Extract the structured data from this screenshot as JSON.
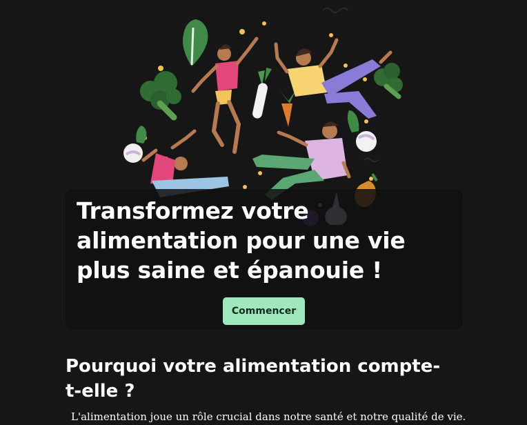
{
  "hero": {
    "title": "Transformez votre alimentation pour une vie plus saine et épanouie !",
    "cta_label": "Commencer",
    "illustration_icon": "floating-people-vegetables-illustration"
  },
  "why_section": {
    "heading": "Pourquoi votre alimentation compte-t-elle ?",
    "text": "L'alimentation joue un rôle crucial dans notre santé et notre qualité de vie."
  },
  "colors": {
    "background": "#161617",
    "card": "#101011",
    "cta_background": "#9fe8bd",
    "cta_text": "#0f2a1b"
  }
}
